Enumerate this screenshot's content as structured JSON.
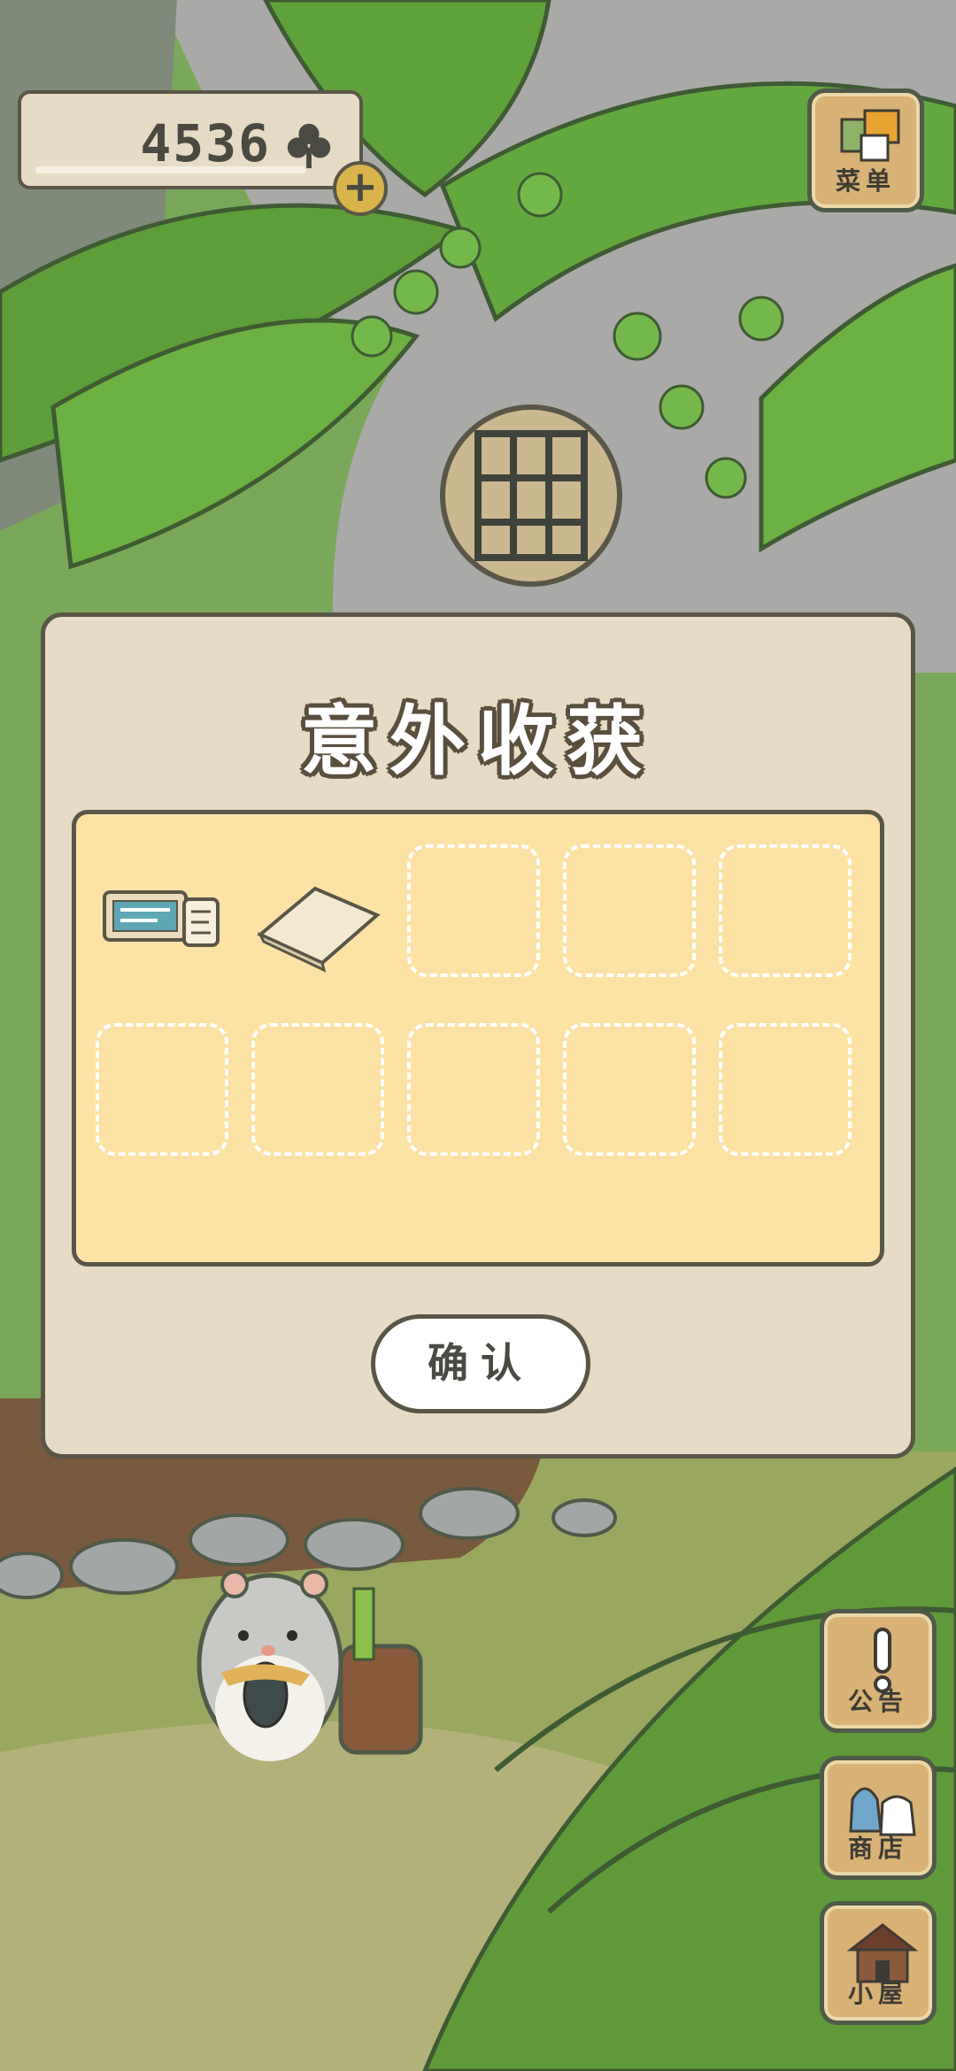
{
  "currency": {
    "count": "4536",
    "icon": "clover-icon"
  },
  "menu": {
    "label": "菜单"
  },
  "dialog": {
    "title": "意外收获",
    "items": [
      {
        "name": "ticket-item",
        "icon": "ticket-icon"
      },
      {
        "name": "paper-item",
        "icon": "paper-icon"
      }
    ],
    "empty_slots": 8,
    "confirm_label": "确认"
  },
  "side_buttons": [
    {
      "label": "公告",
      "icon": "exclamation-icon"
    },
    {
      "label": "商店",
      "icon": "bags-icon"
    },
    {
      "label": "小屋",
      "icon": "house-icon"
    }
  ],
  "colors": {
    "panel_bg": "#e6dbc4",
    "items_bg": "#fde2a6",
    "outline": "#5a5647",
    "button_bg": "#d8b276"
  }
}
